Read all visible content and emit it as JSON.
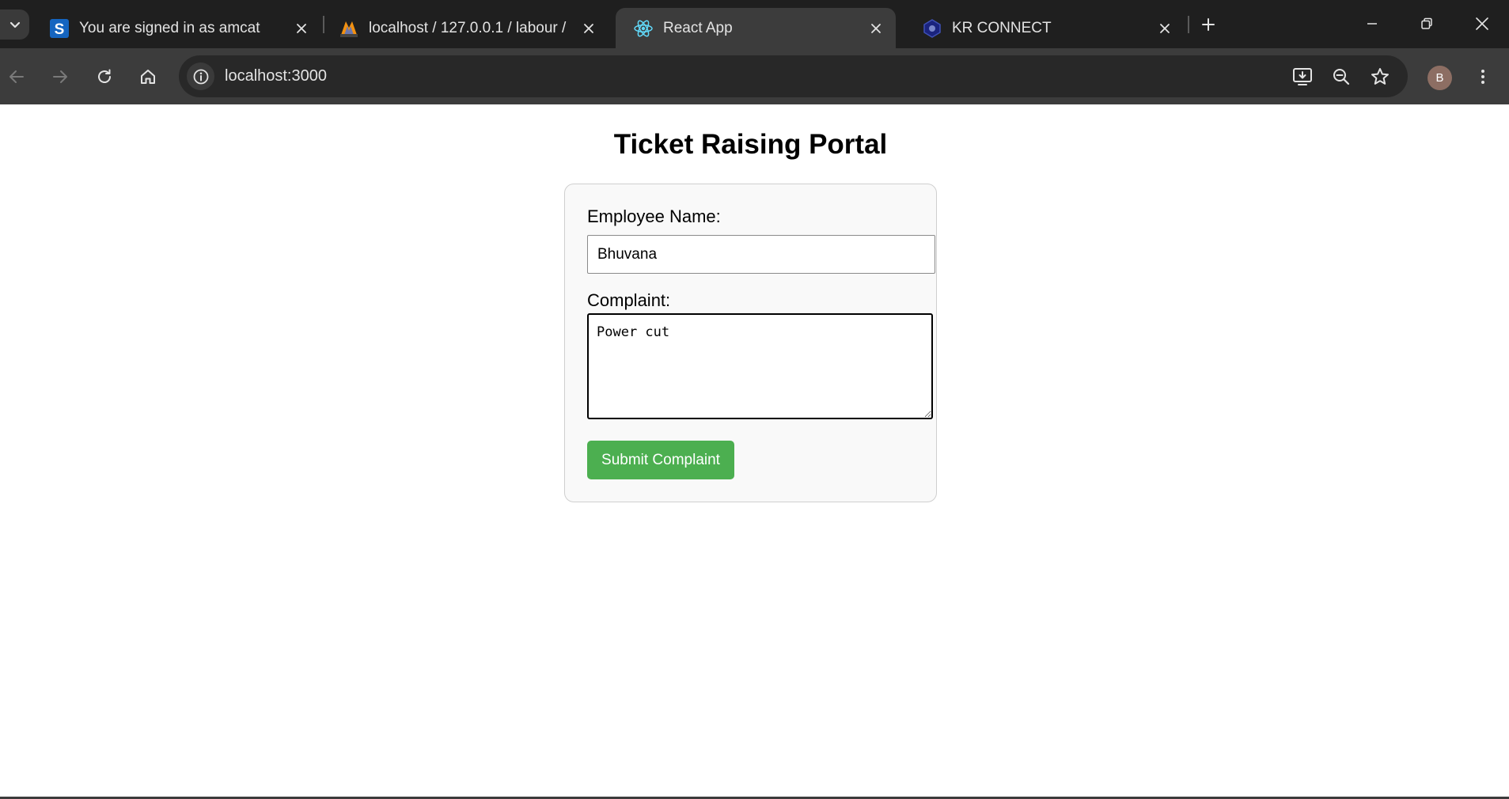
{
  "browser": {
    "tabs": [
      {
        "title": "You are signed in as amcat",
        "favicon": "s-letter-icon",
        "active": false
      },
      {
        "title": "localhost / 127.0.0.1 / labour / l",
        "favicon": "phpmyadmin-icon",
        "active": false
      },
      {
        "title": "React App",
        "favicon": "react-icon",
        "active": true
      },
      {
        "title": "KR CONNECT",
        "favicon": "kr-connect-icon",
        "active": false
      }
    ],
    "address_bar": {
      "url": "localhost:3000"
    },
    "profile_initial": "B"
  },
  "page": {
    "title": "Ticket Raising Portal",
    "form": {
      "name_label": "Employee Name:",
      "name_value": "Bhuvana",
      "complaint_label": "Complaint:",
      "complaint_value": "Power cut",
      "submit_label": "Submit Complaint"
    }
  },
  "colors": {
    "submit_button": "#4caf50",
    "tab_strip": "#1f1f1f",
    "toolbar": "#3c3c3c",
    "card_background": "#f9f9f9"
  }
}
